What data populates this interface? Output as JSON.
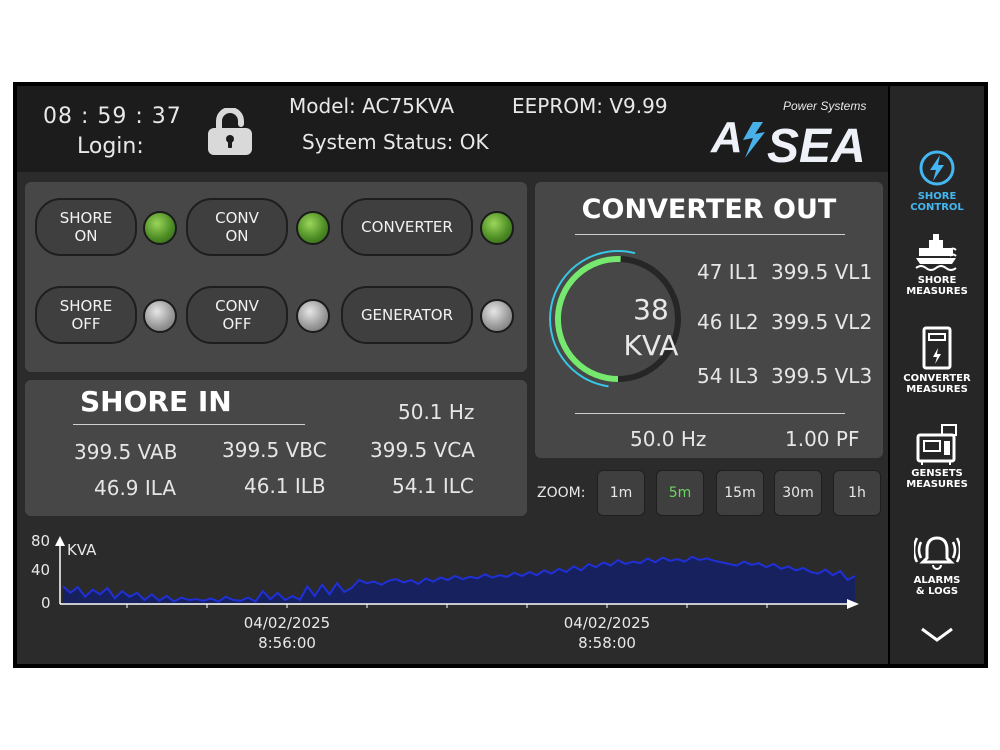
{
  "header": {
    "time": "08 : 59 : 37",
    "login_label": "Login:",
    "model": "Model: AC75KVA",
    "eeprom": "EEPROM: V9.99",
    "system_status": "System Status: OK",
    "brand": {
      "tagline": "Power Systems",
      "name_a": "A",
      "name_rest": "SEA"
    }
  },
  "controls": {
    "shore_on": {
      "line1": "SHORE",
      "line2": "ON",
      "led": "on"
    },
    "conv_on": {
      "line1": "CONV",
      "line2": "ON",
      "led": "on"
    },
    "converter": {
      "label": "CONVERTER",
      "led": "on"
    },
    "shore_off": {
      "line1": "SHORE",
      "line2": "OFF",
      "led": "off"
    },
    "conv_off": {
      "line1": "CONV",
      "line2": "OFF",
      "led": "off"
    },
    "generator": {
      "label": "GENERATOR",
      "led": "off"
    }
  },
  "shore_in": {
    "title": "SHORE IN",
    "frequency": "50.1 Hz",
    "vab": "399.5 VAB",
    "vbc": "399.5 VBC",
    "vca": "399.5 VCA",
    "ila": "46.9 ILA",
    "ilb": "46.1 ILB",
    "ilc": "54.1 ILC"
  },
  "converter_out": {
    "title": "CONVERTER OUT",
    "kva_value": "38",
    "kva_unit": "KVA",
    "gauge_fraction": 0.507,
    "il1": "47 IL1",
    "vl1": "399.5 VL1",
    "il2": "46 IL2",
    "vl2": "399.5 VL2",
    "il3": "54 IL3",
    "vl3": "399.5 VL3",
    "frequency": "50.0 Hz",
    "power_factor": "1.00 PF"
  },
  "zoom": {
    "label": "ZOOM:",
    "options": [
      "1m",
      "5m",
      "15m",
      "30m",
      "1h"
    ],
    "selected": "5m"
  },
  "chart_data": {
    "type": "area",
    "ylabel": "KVA",
    "yticks": [
      "80",
      "40",
      "0"
    ],
    "ylim": [
      0,
      80
    ],
    "xtick_labels": [
      {
        "date": "04/02/2025",
        "time": "8:56:00"
      },
      {
        "date": "04/02/2025",
        "time": "8:58:00"
      }
    ],
    "values": [
      22,
      14,
      21,
      9,
      18,
      12,
      20,
      7,
      16,
      9,
      14,
      5,
      12,
      4,
      10,
      3,
      8,
      5,
      6,
      4,
      7,
      3,
      9,
      5,
      4,
      8,
      3,
      16,
      6,
      14,
      5,
      10,
      5,
      22,
      10,
      24,
      12,
      26,
      15,
      20,
      30,
      26,
      28,
      24,
      29,
      31,
      27,
      30,
      25,
      32,
      28,
      33,
      30,
      35,
      31,
      34,
      32,
      37,
      33,
      36,
      34,
      39,
      35,
      40,
      36,
      42,
      38,
      44,
      40,
      47,
      42,
      50,
      46,
      52,
      48,
      55,
      50,
      53,
      51,
      57,
      52,
      58,
      54,
      56,
      53,
      59,
      55,
      57,
      54,
      52,
      50,
      48,
      53,
      49,
      51,
      46,
      50,
      44,
      47,
      42,
      45,
      40,
      38,
      43,
      36,
      41,
      30,
      35
    ],
    "colors": {
      "line": "#2030d8",
      "fill": "#16215e"
    }
  },
  "sidebar": {
    "items": [
      {
        "line1": "SHORE",
        "line2": "CONTROL",
        "icon": "lightning-icon",
        "active": true
      },
      {
        "line1": "SHORE",
        "line2": "MEASURES",
        "icon": "ship-icon"
      },
      {
        "line1": "CONVERTER",
        "line2": "MEASURES",
        "icon": "converter-icon"
      },
      {
        "line1": "GENSETS",
        "line2": "MEASURES",
        "icon": "genset-icon"
      },
      {
        "line1": "ALARMS",
        "line2": "& LOGS",
        "icon": "bell-icon"
      }
    ],
    "more_icon": "chevron-down-icon",
    "accent": "#44b6f2"
  }
}
